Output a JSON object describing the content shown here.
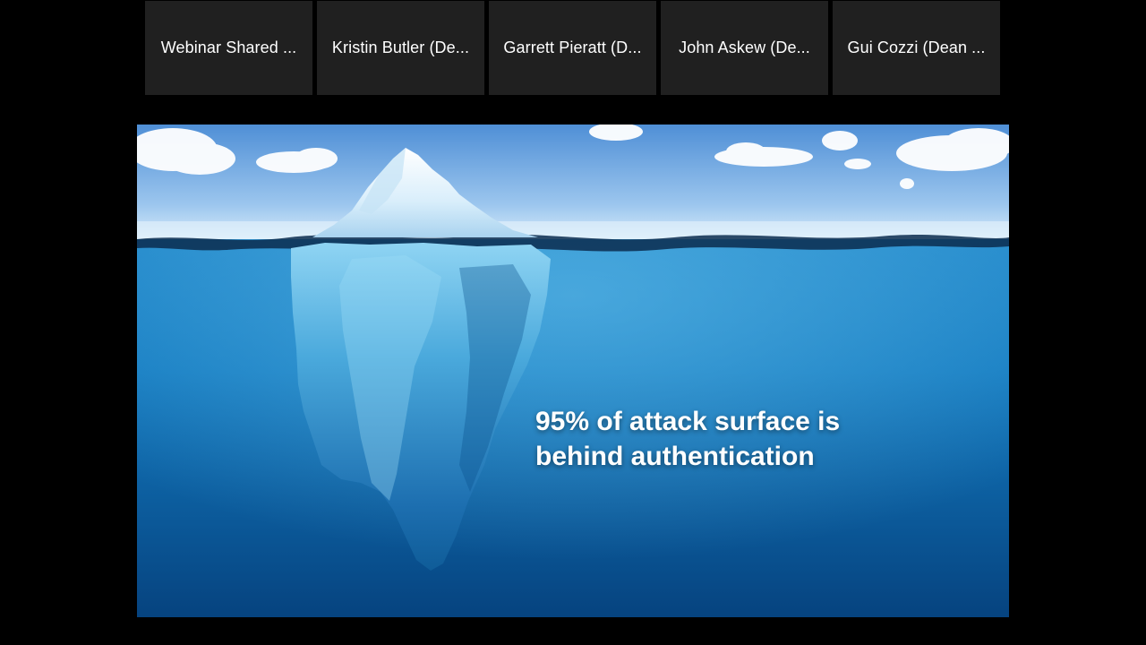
{
  "participants": [
    {
      "name": "Webinar Shared ..."
    },
    {
      "name": "Kristin Butler (De..."
    },
    {
      "name": "Garrett Pieratt (D..."
    },
    {
      "name": "John Askew (De..."
    },
    {
      "name": "Gui Cozzi (Dean ..."
    }
  ],
  "slide": {
    "line1": "95% of attack surface is",
    "line2": "behind authentication"
  },
  "colors": {
    "background": "#000000",
    "tile": "#202020",
    "tile_text": "#ffffff",
    "sky_top": "#4f8fd6",
    "water_deep": "#06437f",
    "caption_text": "#ffffff"
  }
}
